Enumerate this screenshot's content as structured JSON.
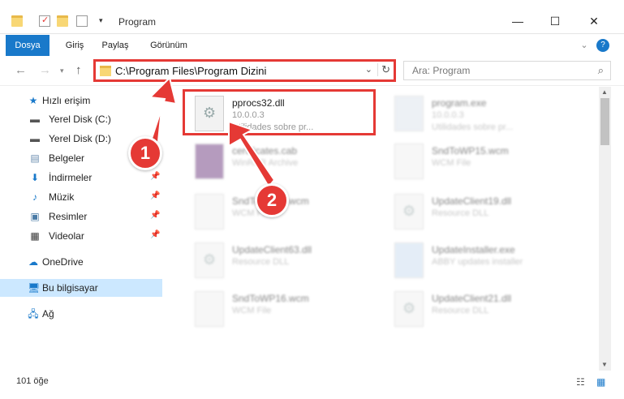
{
  "window": {
    "title": "Program"
  },
  "ribbon": {
    "tabs": [
      {
        "label": "Dosya",
        "active": true
      },
      {
        "label": "Giriş"
      },
      {
        "label": "Paylaş"
      },
      {
        "label": "Görünüm"
      }
    ]
  },
  "address": {
    "path": "C:\\Program Files\\Program Dizini"
  },
  "search": {
    "placeholder": "Ara: Program"
  },
  "sidebar": {
    "items": [
      {
        "label": "Hızlı erişim",
        "icon": "star-icon"
      },
      {
        "label": "Yerel Disk (C:)",
        "icon": "drive-icon"
      },
      {
        "label": "Yerel Disk (D:)",
        "icon": "drive-icon"
      },
      {
        "label": "Belgeler",
        "icon": "documents-icon"
      },
      {
        "label": "İndirmeler",
        "icon": "download-icon"
      },
      {
        "label": "Müzik",
        "icon": "music-icon"
      },
      {
        "label": "Resimler",
        "icon": "pictures-icon"
      },
      {
        "label": "Videolar",
        "icon": "video-icon"
      },
      {
        "label": "OneDrive",
        "icon": "cloud-icon"
      },
      {
        "label": "Bu bilgisayar",
        "icon": "computer-icon",
        "selected": true
      },
      {
        "label": "Ağ",
        "icon": "network-icon"
      }
    ]
  },
  "files": [
    {
      "name": "pprocs32.dll",
      "line1": "10.0.0.3",
      "line2": "Utilidades sobre pr...",
      "highlighted": true
    },
    {
      "name": "program.exe",
      "line1": "10.0.0.3",
      "line2": "Utilidades sobre pr..."
    },
    {
      "name": "certificates.cab",
      "line1": "WinRAR Archive",
      "line2": ""
    },
    {
      "name": "SndToWP15.wcm",
      "line1": "WCM File",
      "line2": ""
    },
    {
      "name": "SndToWP14.wcm",
      "line1": "WCM File",
      "line2": ""
    },
    {
      "name": "UpdateClient19.dll",
      "line1": "Resource DLL",
      "line2": ""
    },
    {
      "name": "UpdateClient63.dll",
      "line1": "Resource DLL",
      "line2": ""
    },
    {
      "name": "UpdateInstaller.exe",
      "line1": "ABBY updates installer",
      "line2": ""
    },
    {
      "name": "SndToWP16.wcm",
      "line1": "WCM File",
      "line2": ""
    },
    {
      "name": "UpdateClient21.dll",
      "line1": "Resource DLL",
      "line2": ""
    }
  ],
  "status": {
    "count": "101 öğe"
  },
  "annotations": {
    "step1": "1",
    "step2": "2"
  },
  "colors": {
    "accent": "#1979ca",
    "highlight": "#e53935",
    "selection": "#cce8ff"
  }
}
